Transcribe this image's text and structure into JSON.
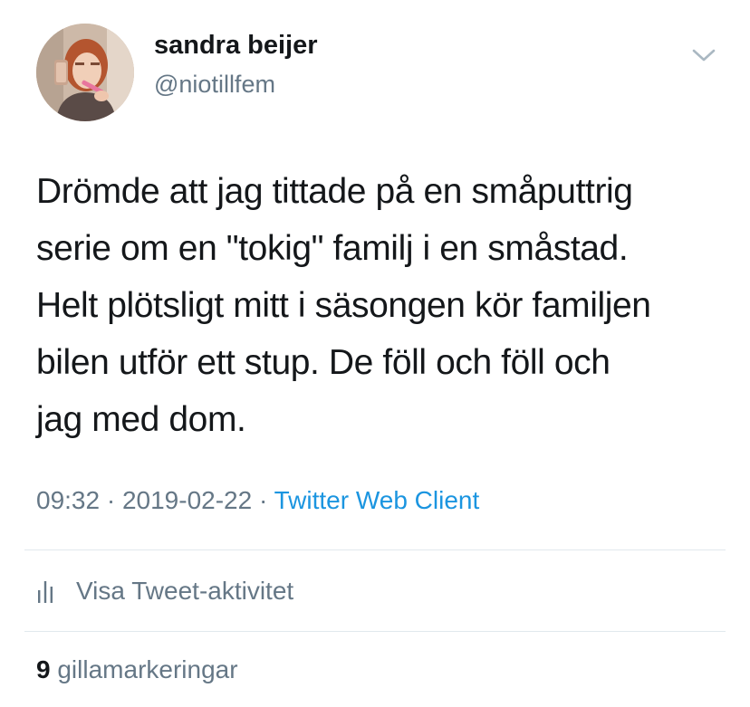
{
  "author": {
    "display_name": "sandra beijer",
    "handle": "@niotillfem"
  },
  "tweet": {
    "lines": [
      "Drömde att jag tittade på en småputtrig",
      "serie om en \"tokig\" familj i en småstad.",
      "Helt plötsligt mitt i säsongen kör familjen",
      "bilen utför ett stup. De föll och föll och",
      "jag med dom."
    ],
    "time": "09:32",
    "separator": " · ",
    "date": "2019-02-22",
    "source": "Twitter Web Client"
  },
  "activity": {
    "icon": "bar-chart-icon",
    "label": "Visa Tweet-aktivitet"
  },
  "likes": {
    "count": "9",
    "label": "gillamarkeringar"
  },
  "icons": {
    "menu": "chevron-down-icon"
  },
  "colors": {
    "text": "#14171a",
    "secondary": "#657786",
    "link": "#1b95e0",
    "divider": "#e1e8ed"
  }
}
